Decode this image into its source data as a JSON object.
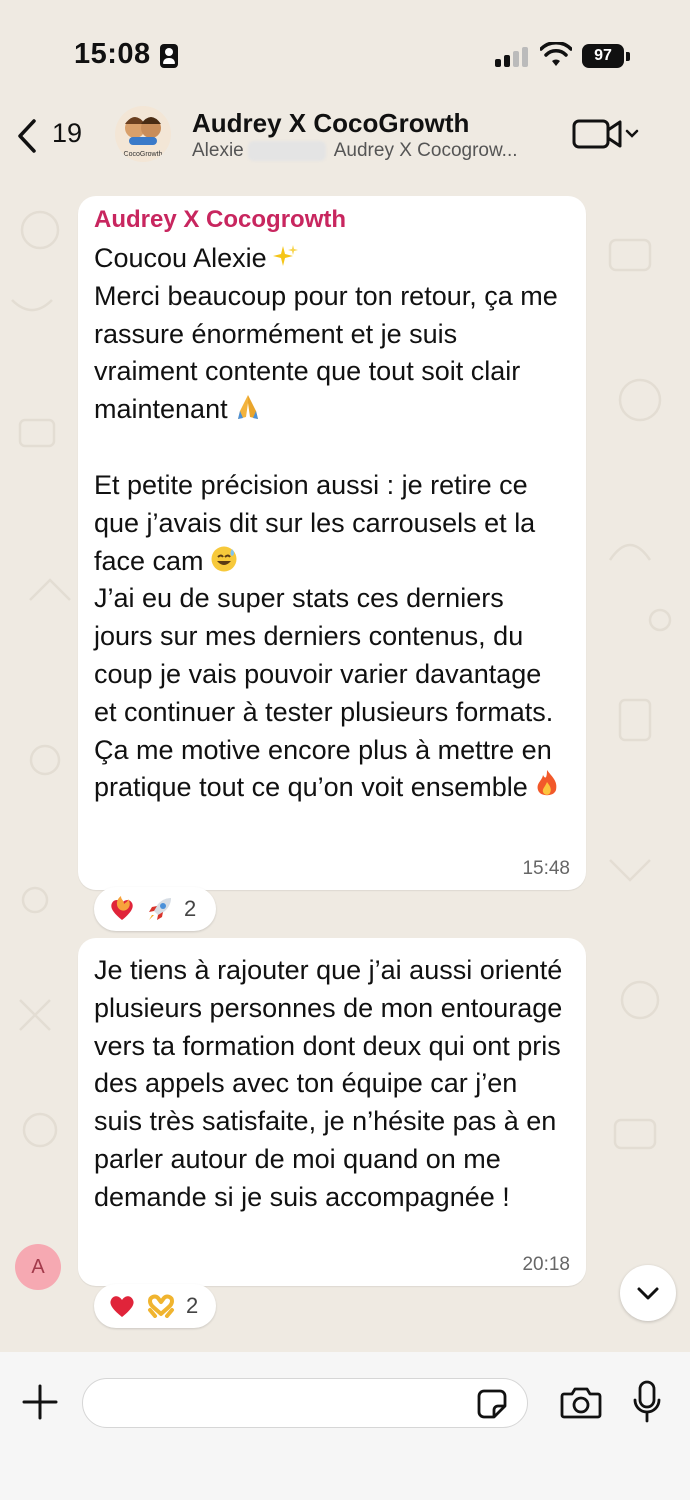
{
  "status_bar": {
    "time": "15:08",
    "battery": "97"
  },
  "header": {
    "back_count": "19",
    "title": "Audrey X CocoGrowth",
    "subtitle_member": "Alexie",
    "subtitle_rest": "Audrey X Cocogrow...",
    "avatar_text": "CocoGrowth"
  },
  "messages": [
    {
      "sender": "Audrey X Cocogrowth",
      "paragraphs": [
        "Coucou Alexie",
        "Merci beaucoup pour ton retour, ça me rassure énormément et je suis vraiment contente que tout soit clair maintenant",
        "Et petite précision aussi : je retire ce que j’avais dit sur les carrousels et la face cam",
        "J’ai eu de super stats ces derniers jours sur mes derniers contenus, du coup je vais pouvoir varier davantage et continuer à tester plusieurs formats.",
        "Ça me motive encore plus à mettre en pratique tout ce qu’on voit ensemble"
      ],
      "emojis": [
        "sparkles",
        "folded-hands",
        "sweat-smile",
        "fire"
      ],
      "time": "15:48",
      "reactions": {
        "icons": [
          "heart-on-fire",
          "rocket"
        ],
        "count": "2"
      }
    },
    {
      "sender": "",
      "paragraphs": [
        "Je tiens à rajouter que j’ai aussi orienté plusieurs personnes de mon entourage vers ta formation dont deux qui ont pris des appels avec ton équipe car j’en suis très satisfaite, je n’hésite pas à en parler autour de moi quand on me demande si je suis accompagnée !"
      ],
      "time": "20:18",
      "reactions": {
        "icons": [
          "red-heart",
          "heart-hands"
        ],
        "count": "2"
      }
    }
  ],
  "sender_avatar_initial": "A",
  "input": {
    "value": "",
    "placeholder": ""
  },
  "colors": {
    "sender_name": "#c8265f",
    "background": "#efeae2",
    "bubble": "#ffffff"
  }
}
